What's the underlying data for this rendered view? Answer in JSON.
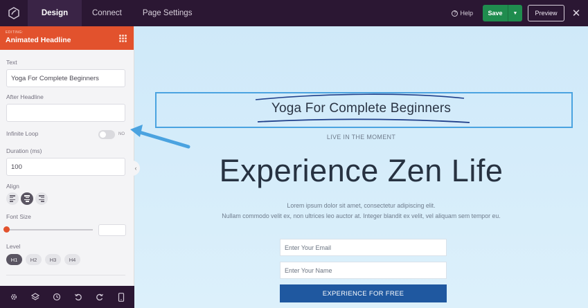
{
  "topbar": {
    "tabs": [
      {
        "label": "Design",
        "active": true
      },
      {
        "label": "Connect",
        "active": false
      },
      {
        "label": "Page Settings",
        "active": false
      }
    ],
    "help_label": "Help",
    "help_glyph": "?",
    "save_label": "Save",
    "save_caret": "▼",
    "preview_label": "Preview",
    "close_glyph": "✕"
  },
  "sidebar": {
    "editing_kicker": "EDITING:",
    "editing_title": "Animated Headline",
    "fields": {
      "text_label": "Text",
      "text_value": "Yoga For Complete Beginners",
      "after_headline_label": "After Headline",
      "after_headline_value": "",
      "infinite_loop_label": "Infinite Loop",
      "infinite_loop_state": "NO",
      "duration_label": "Duration (ms)",
      "duration_value": "100",
      "align_label": "Align",
      "align_selected": "center",
      "font_size_label": "Font Size",
      "font_size_value": "",
      "level_label": "Level",
      "levels": [
        "H1",
        "H2",
        "H3",
        "H4"
      ],
      "level_selected": "H1"
    },
    "collapse_glyph": "‹"
  },
  "bottom_toolbar": {
    "icons": [
      "settings-icon",
      "layers-icon",
      "history-icon",
      "undo-icon",
      "redo-icon",
      "mobile-preview-icon"
    ]
  },
  "canvas": {
    "headline": "Yoga For Complete Beginners",
    "kicker": "LIVE IN THE MOMENT",
    "hero_title": "Experience Zen Life",
    "lorem_line1": "Lorem ipsum dolor sit amet, consectetur adipiscing elit.",
    "lorem_line2": "Nullam commodo velit ex, non ultrices leo auctor at. Integer blandit ex velit, vel aliquam sem tempor eu.",
    "email_placeholder": "Enter Your Email",
    "name_placeholder": "Enter Your Name",
    "cta_label": "EXPERIENCE FOR FREE"
  },
  "colors": {
    "topbar_bg": "#2b1733",
    "editing_header": "#e2522d",
    "save_button": "#1f8c4e",
    "selection_outline": "#4aa3e0",
    "cta_button": "#1f58a0",
    "annotation_arrow": "#4aa3e0"
  }
}
